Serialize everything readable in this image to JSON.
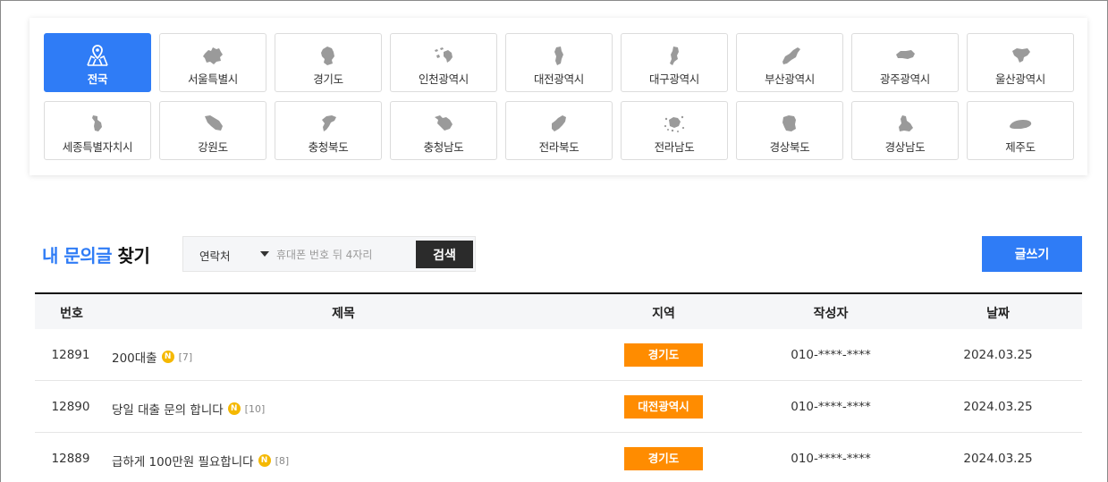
{
  "regions": [
    {
      "label": "전국",
      "icon": "location-pin-map-icon",
      "active": true
    },
    {
      "label": "서울특별시",
      "icon": "seoul-map-icon"
    },
    {
      "label": "경기도",
      "icon": "gyeonggi-map-icon"
    },
    {
      "label": "인천광역시",
      "icon": "incheon-map-icon"
    },
    {
      "label": "대전광역시",
      "icon": "daejeon-map-icon"
    },
    {
      "label": "대구광역시",
      "icon": "daegu-map-icon"
    },
    {
      "label": "부산광역시",
      "icon": "busan-map-icon"
    },
    {
      "label": "광주광역시",
      "icon": "gwangju-map-icon"
    },
    {
      "label": "울산광역시",
      "icon": "ulsan-map-icon"
    },
    {
      "label": "세종특별자치시",
      "icon": "sejong-map-icon"
    },
    {
      "label": "강원도",
      "icon": "gangwon-map-icon"
    },
    {
      "label": "충청북도",
      "icon": "chungbuk-map-icon"
    },
    {
      "label": "충청남도",
      "icon": "chungnam-map-icon"
    },
    {
      "label": "전라북도",
      "icon": "jeonbuk-map-icon"
    },
    {
      "label": "전라남도",
      "icon": "jeonnam-map-icon"
    },
    {
      "label": "경상북도",
      "icon": "gyeongbuk-map-icon"
    },
    {
      "label": "경상남도",
      "icon": "gyeongnam-map-icon"
    },
    {
      "label": "제주도",
      "icon": "jeju-map-icon"
    }
  ],
  "search": {
    "title_highlight": "내 문의글",
    "title_rest": "찾기",
    "select_label": "연락처",
    "placeholder": "휴대폰 번호 뒤 4자리",
    "button_label": "검색"
  },
  "write_button_label": "글쓰기",
  "table": {
    "headers": {
      "number": "번호",
      "title": "제목",
      "region": "지역",
      "author": "작성자",
      "date": "날짜"
    },
    "rows": [
      {
        "number": "12891",
        "title": "200대출",
        "badge": "N",
        "replies": "[7]",
        "region": "경기도",
        "author": "010-****-****",
        "date": "2024.03.25"
      },
      {
        "number": "12890",
        "title": "당일 대출 문의 합니다",
        "badge": "N",
        "replies": "[10]",
        "region": "대전광역시",
        "author": "010-****-****",
        "date": "2024.03.25"
      },
      {
        "number": "12889",
        "title": "급하게 100만원 필요합니다",
        "badge": "N",
        "replies": "[8]",
        "region": "경기도",
        "author": "010-****-****",
        "date": "2024.03.25"
      }
    ]
  },
  "colors": {
    "accent": "#2f7cf6",
    "region_tag": "#ff8c00",
    "new_badge": "#f5b800",
    "dark_button": "#2b2b2b"
  }
}
